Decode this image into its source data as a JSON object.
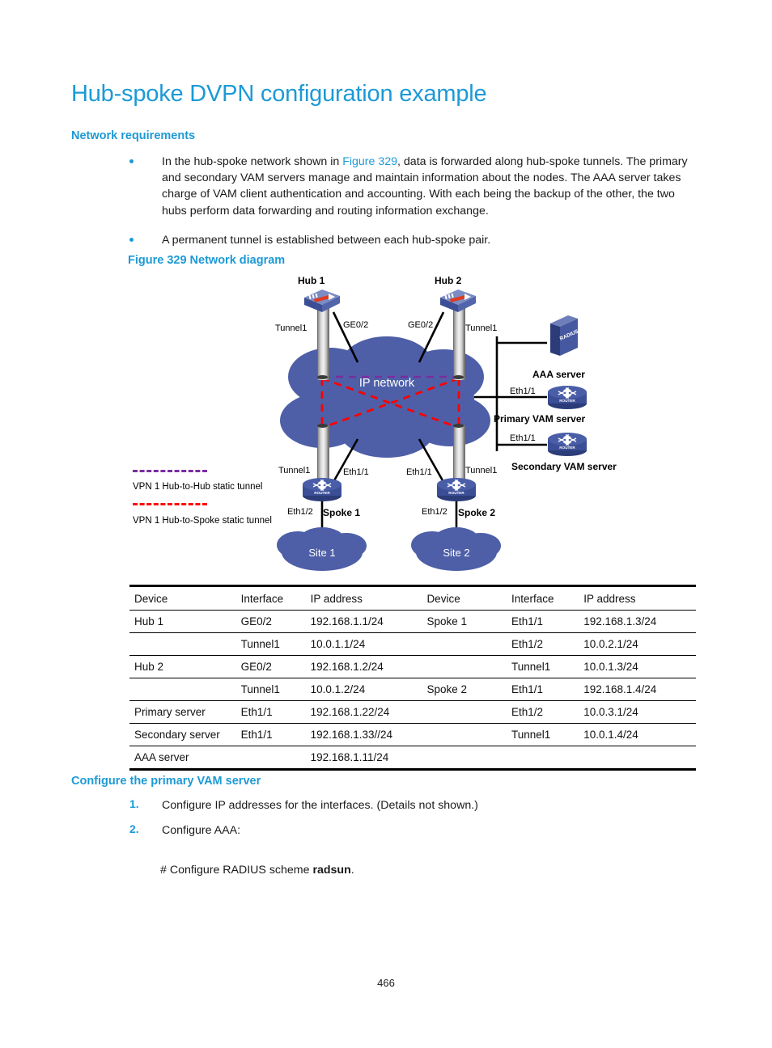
{
  "page": {
    "title": "Hub-spoke DVPN configuration example",
    "page_number": "466"
  },
  "sections": {
    "network_requirements": {
      "heading": "Network requirements",
      "bullets": [
        {
          "pre": "In the hub-spoke network shown in ",
          "link": "Figure 329",
          "post": ", data is forwarded along hub-spoke tunnels. The primary and secondary VAM servers manage and maintain information about the nodes. The AAA server takes charge of VAM client authentication and accounting. With each being the backup of the other, the two hubs perform data forwarding and routing information exchange."
        },
        {
          "pre": "A permanent tunnel is established between each hub-spoke pair.",
          "link": "",
          "post": ""
        }
      ]
    },
    "figure": {
      "caption": "Figure 329 Network diagram",
      "cloud_label": "IP network",
      "nodes": {
        "hub1": "Hub 1",
        "hub2": "Hub 2",
        "spoke1": "Spoke 1",
        "spoke2": "Spoke 2",
        "site1": "Site 1",
        "site2": "Site 2",
        "aaa_server": "AAA server",
        "primary_vam": "Primary VAM server",
        "secondary_vam": "Secondary VAM server",
        "radius_badge": "RADIUS",
        "router_badge": "ROUTER"
      },
      "interface_labels": {
        "hub1_tunnel": "Tunnel1",
        "hub1_ge": "GE0/2",
        "hub2_ge": "GE0/2",
        "hub2_tunnel": "Tunnel1",
        "spoke1_tunnel": "Tunnel1",
        "spoke1_eth11": "Eth1/1",
        "spoke1_eth12": "Eth1/2",
        "spoke2_eth11": "Eth1/1",
        "spoke2_tunnel": "Tunnel1",
        "spoke2_eth12": "Eth1/2",
        "primary_eth": "Eth1/1",
        "secondary_eth": "Eth1/1"
      },
      "legend": [
        {
          "label": "VPN 1 Hub-to-Hub  static tunnel",
          "color": "#7b2d9e"
        },
        {
          "label": "VPN 1 Hub-to-Spoke  static tunnel",
          "color": "#ff0000"
        }
      ],
      "colors": {
        "cloud": "#4e5fa8",
        "device_blue": "#3b4e96",
        "heading_blue": "#1c9ad6"
      }
    },
    "table": {
      "headers": [
        "Device",
        "Interface",
        "IP address",
        "Device",
        "Interface",
        "IP address"
      ],
      "rows": [
        {
          "cells": [
            "Hub 1",
            "GE0/2",
            "192.168.1.1/24",
            "Spoke 1",
            "Eth1/1",
            "192.168.1.3/24"
          ],
          "rule": true
        },
        {
          "cells": [
            "",
            "Tunnel1",
            "10.0.1.1/24",
            "",
            "Eth1/2",
            "10.0.2.1/24"
          ],
          "rule": true
        },
        {
          "cells": [
            "Hub 2",
            "GE0/2",
            "192.168.1.2/24",
            "",
            "Tunnel1",
            "10.0.1.3/24"
          ],
          "rule": true
        },
        {
          "cells": [
            "",
            "Tunnel1",
            "10.0.1.2/24",
            "Spoke 2",
            "Eth1/1",
            "192.168.1.4/24"
          ],
          "rule": true
        },
        {
          "cells": [
            "Primary server",
            "Eth1/1",
            "192.168.1.22/24",
            "",
            "Eth1/2",
            "10.0.3.1/24"
          ],
          "rule": true
        },
        {
          "cells": [
            "Secondary server",
            "Eth1/1",
            "192.168.1.33//24",
            "",
            "Tunnel1",
            "10.0.1.4/24"
          ],
          "rule": true
        },
        {
          "cells": [
            "AAA server",
            "",
            "192.168.1.11/24",
            "",
            "",
            ""
          ],
          "rule": false
        }
      ]
    },
    "configure_primary": {
      "heading": "Configure the primary VAM server",
      "steps": [
        {
          "num": "1.",
          "text": "Configure IP addresses for the interfaces. (Details not shown.)"
        },
        {
          "num": "2.",
          "text": "Configure AAA:"
        }
      ],
      "command_prefix": "# Configure RADIUS scheme ",
      "command_bold": "radsun",
      "command_suffix": "."
    }
  }
}
